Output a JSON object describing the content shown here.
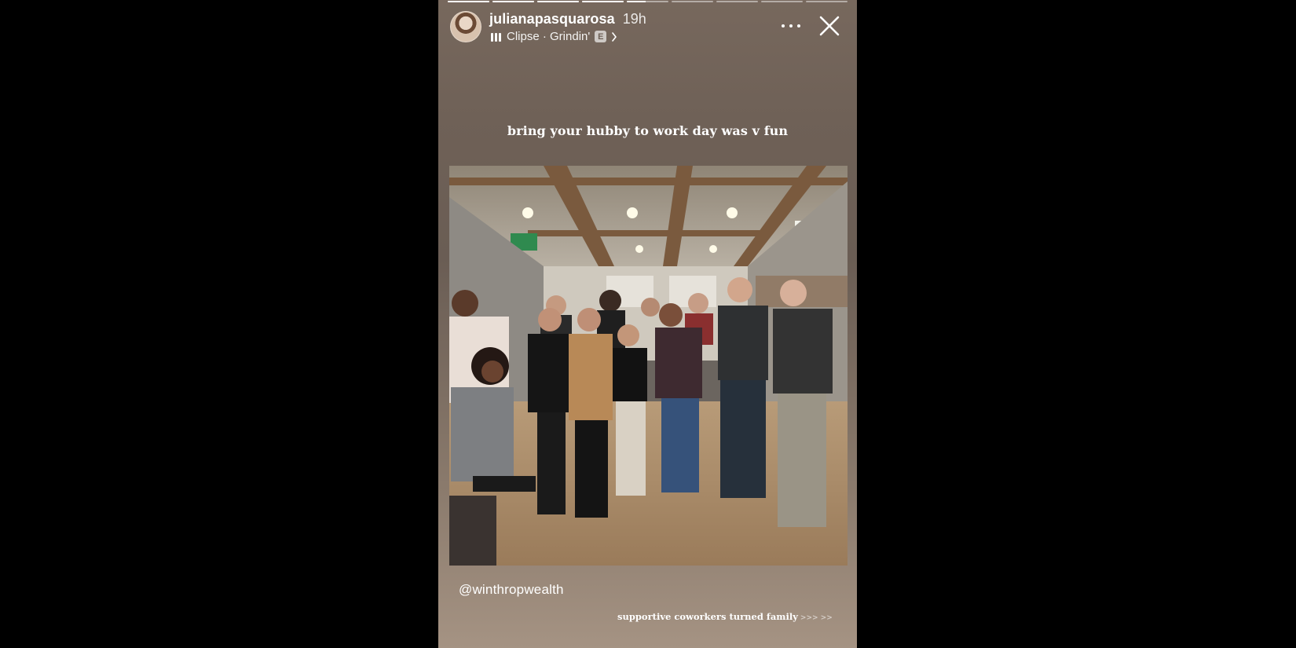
{
  "story": {
    "progress_segments": [
      1,
      1,
      1,
      1,
      0.45,
      0,
      0,
      0,
      0
    ],
    "user": {
      "username": "julianapasquarosa",
      "time_ago": "19h"
    },
    "music": {
      "title": "Clipse · Grindin'",
      "explicit_badge": "E"
    },
    "caption_top": "bring your hubby to work day was v fun",
    "mention": "@winthropwealth",
    "caption_bottom": "supportive coworkers turned family",
    "caption_bottom_arrows": ">>> >>",
    "colors": {
      "background": "#000000",
      "story_gradient_top": "#77685d",
      "story_gradient_bottom": "#a59383",
      "text": "#ffffff"
    },
    "icons": [
      "music-bars-icon",
      "explicit-icon",
      "chevron-right-icon",
      "more-icon",
      "close-icon"
    ]
  }
}
